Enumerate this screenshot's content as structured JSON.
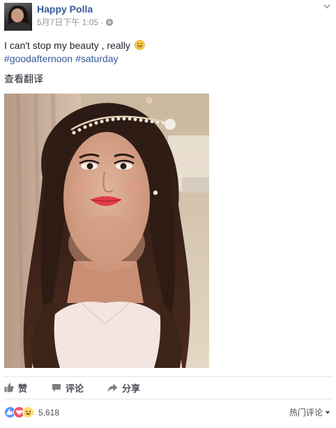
{
  "post": {
    "author": "Happy Polla",
    "timestamp": "5月7日下午 1:05 ·",
    "caption": "I can't stop my beauty , really",
    "hashtags": [
      "#goodafternoon",
      "#saturday"
    ],
    "translate_link": "查看翻译"
  },
  "icons": {
    "avatar": "profile-photo",
    "privacy": "globe-icon",
    "menu": "chevron-down-icon",
    "caption_emoji": "smiling-emoji-icon",
    "like": "thumbs-up-icon",
    "comment": "comment-bubble-icon",
    "share": "share-arrow-icon"
  },
  "actions": {
    "like_label": "赞",
    "comment_label": "评论",
    "share_label": "分享"
  },
  "reactions": {
    "types": [
      "like",
      "love",
      "haha"
    ],
    "count": "5,618"
  },
  "sort": {
    "label": "热门评论"
  },
  "colors": {
    "link": "#365899",
    "text": "#1d2129",
    "meta": "#90949c",
    "action_text": "#4b4f56",
    "reaction_like": "#5890ff",
    "reaction_love": "#f25268",
    "reaction_haha": "#ffd972"
  }
}
